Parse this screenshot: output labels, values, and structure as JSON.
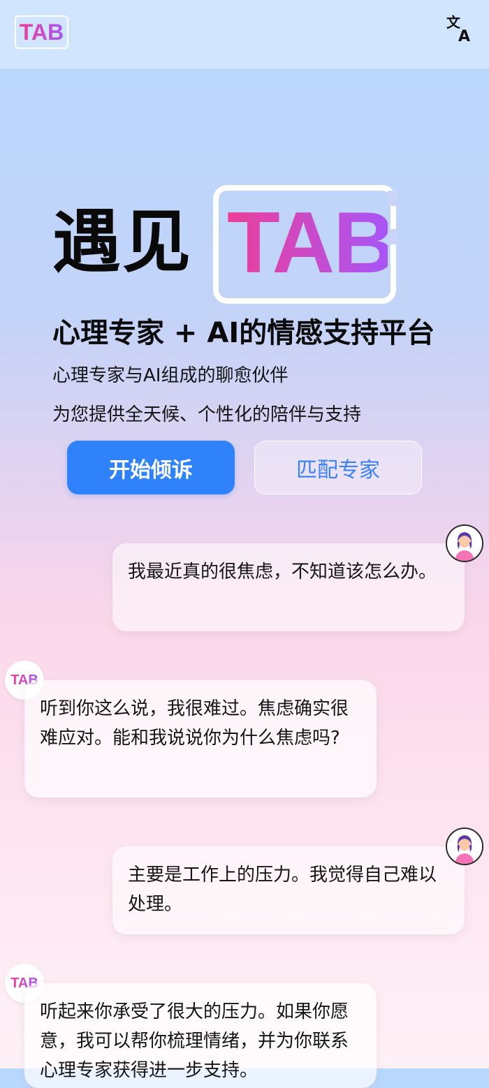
{
  "header": {
    "logo_text": "TAB",
    "translate_icon": "translate-icon"
  },
  "hero": {
    "headline_prefix": "遇见",
    "headline_brand": "TAB",
    "subtitle": "心理专家 + AI的情感支持平台",
    "description_lines": [
      "心理专家与AI组成的聊愈伙伴",
      "为您提供全天候、个性化的陪伴与支持"
    ]
  },
  "actions": {
    "primary_label": "开始倾诉",
    "secondary_label": "匹配专家"
  },
  "chat": {
    "ai_avatar_text": "TAB",
    "user_avatar_icon": "user-avatar-icon",
    "messages": [
      {
        "sender": "user",
        "text": "我最近真的很焦虑，不知道该怎么办。"
      },
      {
        "sender": "ai",
        "text": "听到你这么说，我很难过。焦虑确实很难应对。能和我说说你为什么焦虑吗?"
      },
      {
        "sender": "user",
        "text": "主要是工作上的压力。我觉得自己难以处理。"
      },
      {
        "sender": "ai",
        "text": "听起来你承受了很大的压力。如果你愿意，我可以帮你梳理情绪，并为你联系心理专家获得进一步支持。"
      }
    ]
  },
  "colors": {
    "brand_gradient_start": "#ec3f98",
    "brand_gradient_end": "#a855f7",
    "primary_button": "#2f82fa",
    "secondary_text": "#3b82f6"
  }
}
